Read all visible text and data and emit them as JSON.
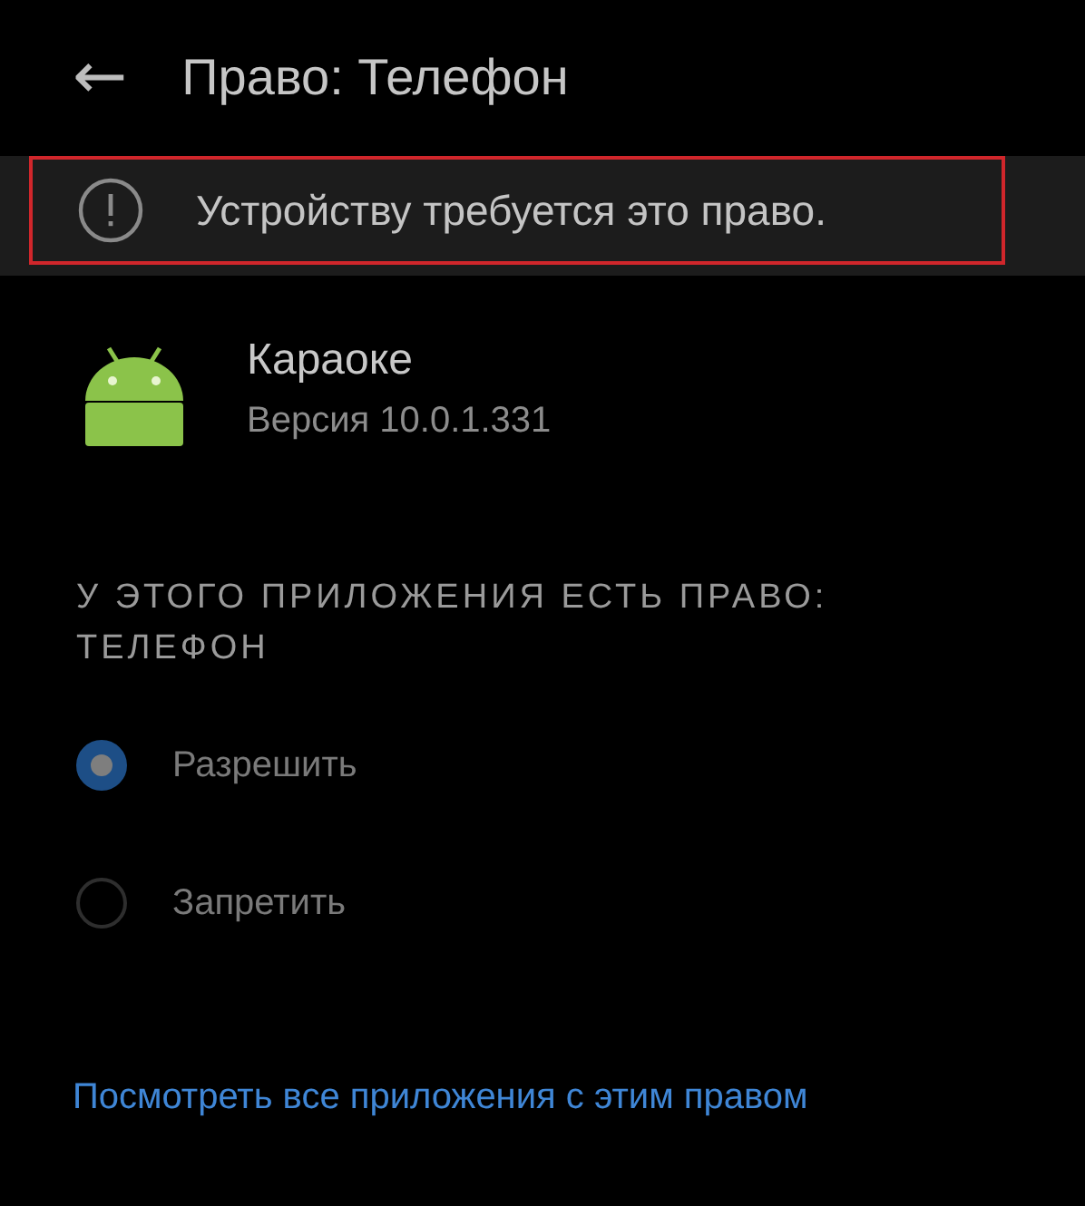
{
  "header": {
    "back": "←",
    "title": "Право: Телефон"
  },
  "notice": {
    "text": "Устройству требуется это право.",
    "highlighted": true
  },
  "app": {
    "name": "Караоке",
    "version": "Версия 10.0.1.331"
  },
  "section": {
    "title": "У ЭТОГО ПРИЛОЖЕНИЯ ЕСТЬ ПРАВО: ТЕЛЕФОН"
  },
  "options": [
    {
      "label": "Разрешить",
      "selected": true,
      "disabled": true
    },
    {
      "label": "Запретить",
      "selected": false,
      "disabled": true
    }
  ],
  "link": "Посмотреть все приложения с этим правом"
}
